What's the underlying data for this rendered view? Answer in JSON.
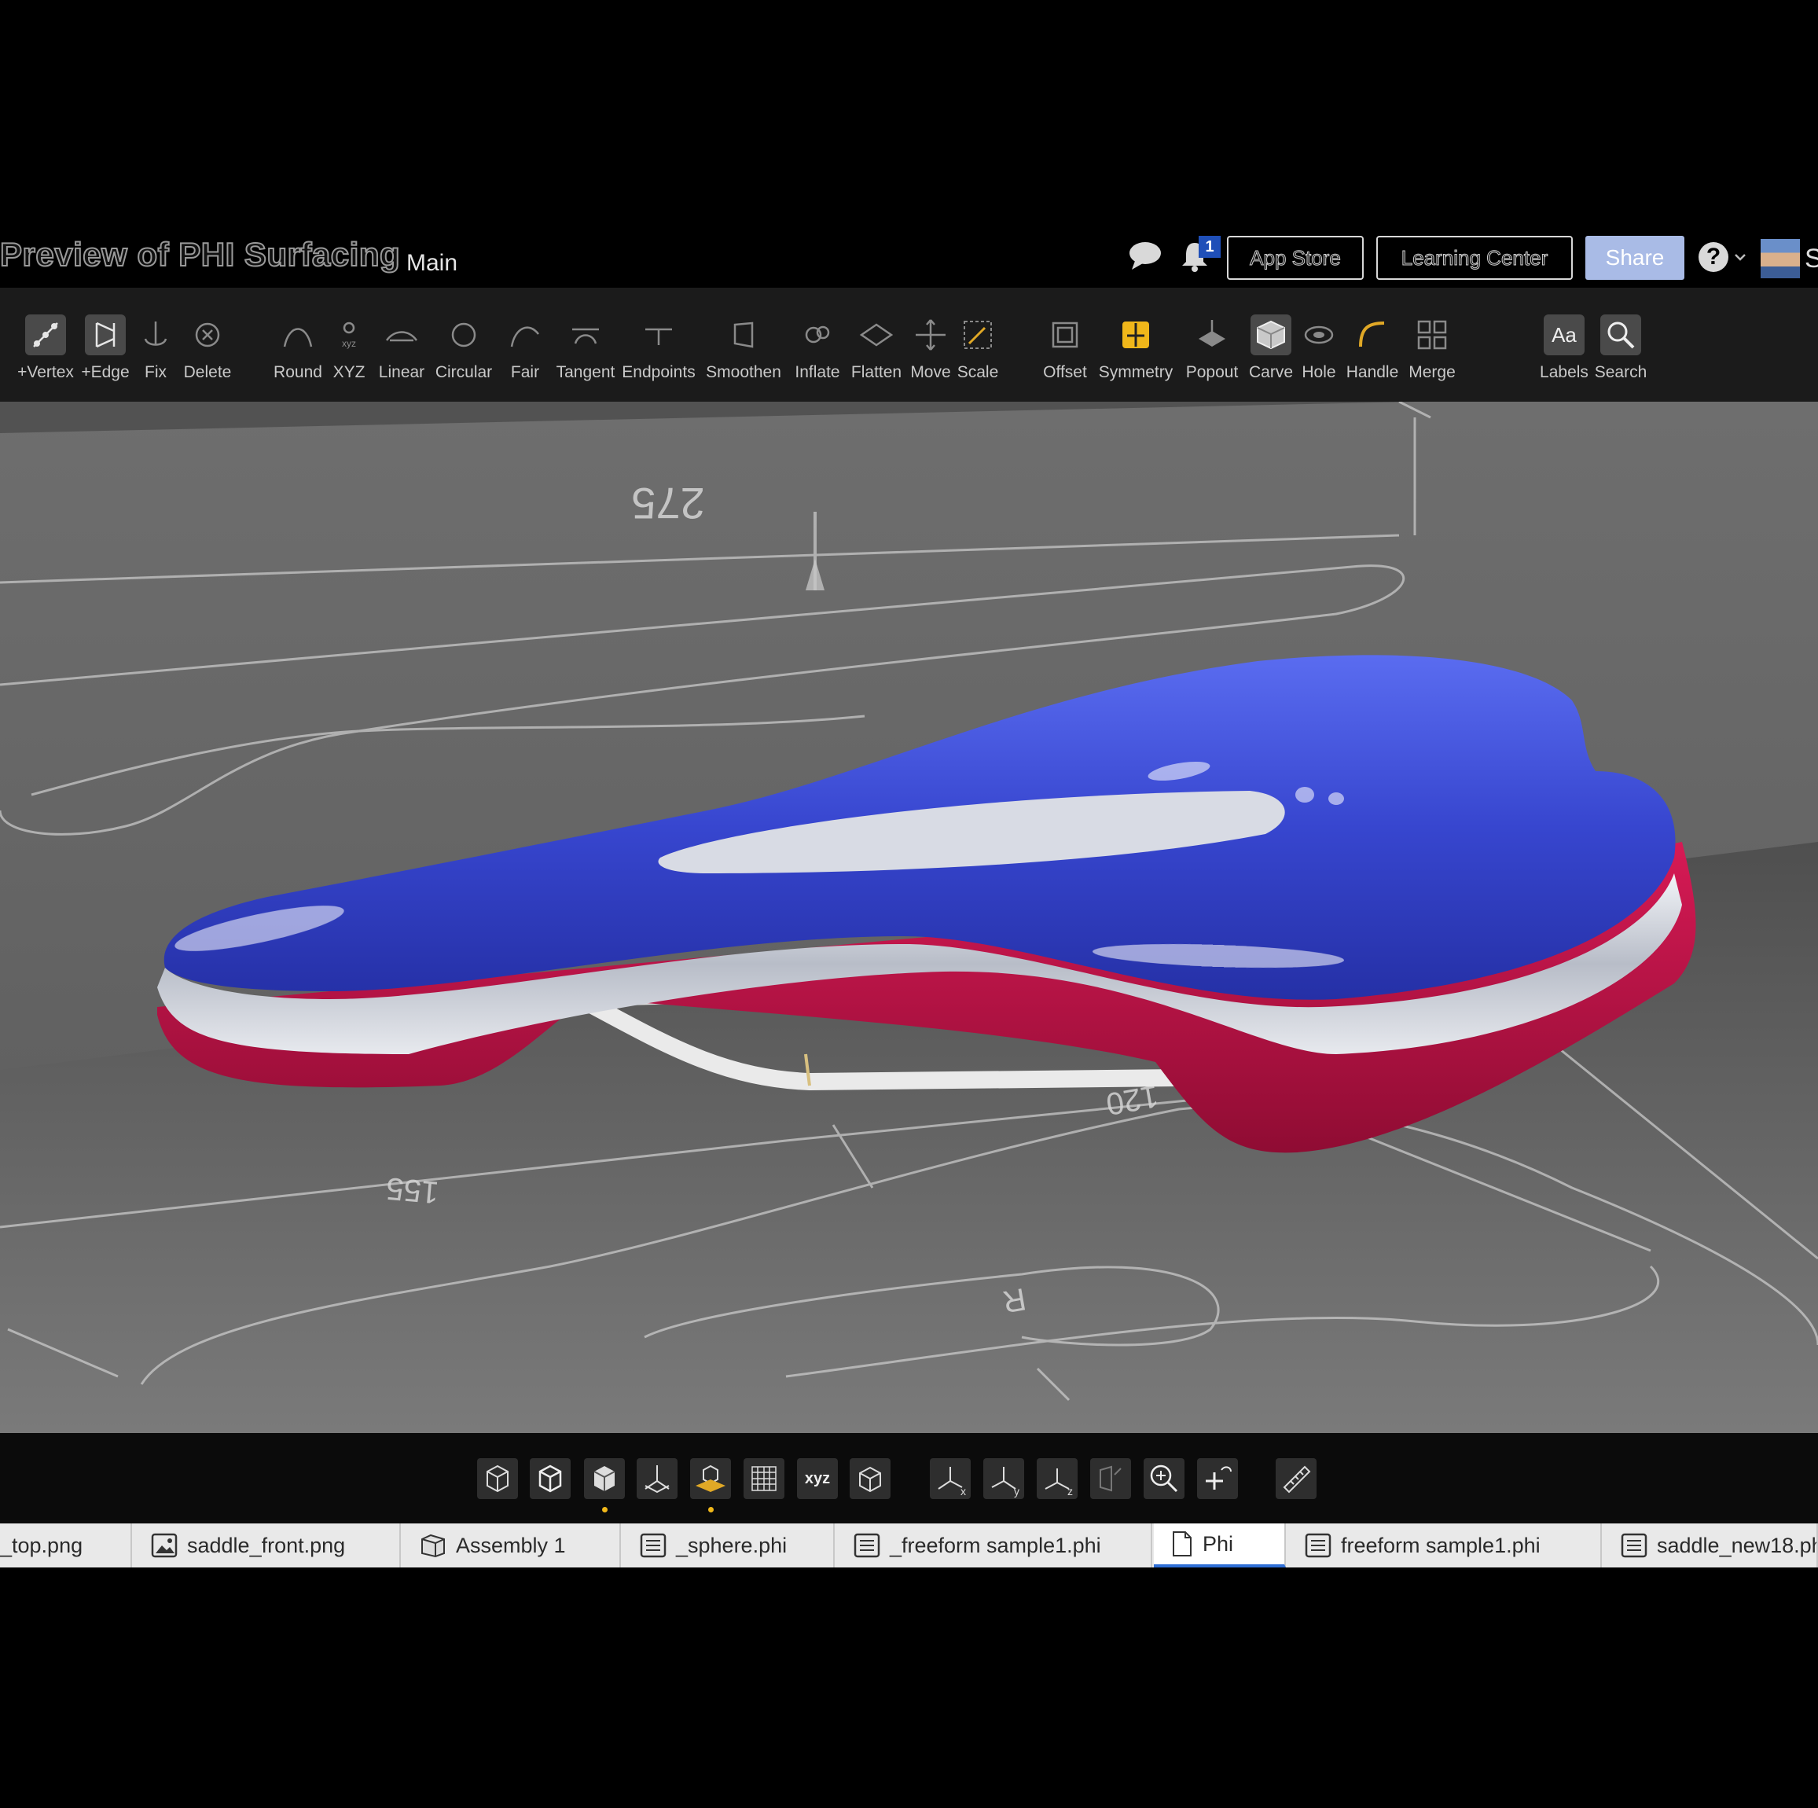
{
  "header": {
    "title": "Preview of PHI Surfacing",
    "branch": "Main",
    "notification_count": "1",
    "app_store_label": "App Store",
    "learning_center_label": "Learning Center",
    "share_label": "Share",
    "help_label": "?",
    "user_initial": "S"
  },
  "toolbar": {
    "tools": [
      {
        "label": "+Vertex",
        "icon": "add-vertex-icon"
      },
      {
        "label": "+Edge",
        "icon": "add-edge-icon"
      },
      {
        "label": "Fix",
        "icon": "fix-anchor-icon"
      },
      {
        "label": "Delete",
        "icon": "delete-circle-x-icon"
      },
      {
        "label": "Round",
        "icon": "round-curve-icon"
      },
      {
        "label": "XYZ",
        "icon": "xyz-point-icon"
      },
      {
        "label": "Linear",
        "icon": "linear-icon"
      },
      {
        "label": "Circular",
        "icon": "circular-icon"
      },
      {
        "label": "Fair",
        "icon": "fair-curve-icon"
      },
      {
        "label": "Tangent",
        "icon": "tangent-icon"
      },
      {
        "label": "Endpoints",
        "icon": "endpoints-icon"
      },
      {
        "label": "Smoothen",
        "icon": "smoothen-icon"
      },
      {
        "label": "Inflate",
        "icon": "inflate-icon"
      },
      {
        "label": "Flatten",
        "icon": "flatten-icon"
      },
      {
        "label": "Move",
        "icon": "move-arrows-icon"
      },
      {
        "label": "Scale",
        "icon": "scale-icon"
      },
      {
        "label": "Offset",
        "icon": "offset-icon"
      },
      {
        "label": "Symmetry",
        "icon": "symmetry-icon"
      },
      {
        "label": "Popout",
        "icon": "popout-icon"
      },
      {
        "label": "Carve",
        "icon": "carve-icon"
      },
      {
        "label": "Hole",
        "icon": "hole-icon"
      },
      {
        "label": "Handle",
        "icon": "handle-icon"
      },
      {
        "label": "Merge",
        "icon": "merge-icon"
      },
      {
        "label": "Labels",
        "icon": "labels-aa-icon",
        "glyph": "Aa"
      },
      {
        "label": "Search",
        "icon": "search-icon"
      }
    ]
  },
  "viewport": {
    "dimension_labels": [
      "275",
      "155",
      "120",
      "R"
    ],
    "model": "saddle-model",
    "colors": {
      "top": "#3b4bd8",
      "rim": "#d8dde6",
      "bottom": "#c0154a",
      "background": "#5e5e5e"
    }
  },
  "viewbar": {
    "buttons": [
      {
        "icon": "wireframe-cube-icon"
      },
      {
        "icon": "outline-cube-icon"
      },
      {
        "icon": "solid-cube-icon",
        "active_dot": true
      },
      {
        "icon": "axes-plane-icon"
      },
      {
        "icon": "ground-cube-icon",
        "active_dot": true
      },
      {
        "icon": "grid-icon"
      },
      {
        "icon": "xyz-toggle-icon",
        "glyph": "xyz"
      },
      {
        "icon": "box-view-icon"
      },
      {
        "icon": "view-x-icon",
        "glyph": "x"
      },
      {
        "icon": "view-y-icon",
        "glyph": "y"
      },
      {
        "icon": "view-z-icon",
        "glyph": "z"
      },
      {
        "icon": "rotate-view-icon"
      },
      {
        "icon": "zoom-fit-icon"
      },
      {
        "icon": "add-orbit-icon"
      },
      {
        "icon": "ruler-icon"
      }
    ]
  },
  "tabs": [
    {
      "label": "_top.png",
      "icon": "image-icon"
    },
    {
      "label": "saddle_front.png",
      "icon": "image-icon"
    },
    {
      "label": "Assembly 1",
      "icon": "assembly-icon"
    },
    {
      "label": "_sphere.phi",
      "icon": "document-icon"
    },
    {
      "label": "_freeform sample1.phi",
      "icon": "document-icon"
    },
    {
      "label": "Phi",
      "icon": "file-icon",
      "active": true
    },
    {
      "label": "freeform sample1.phi",
      "icon": "document-icon"
    },
    {
      "label": "saddle_new18.ph",
      "icon": "document-icon"
    }
  ]
}
